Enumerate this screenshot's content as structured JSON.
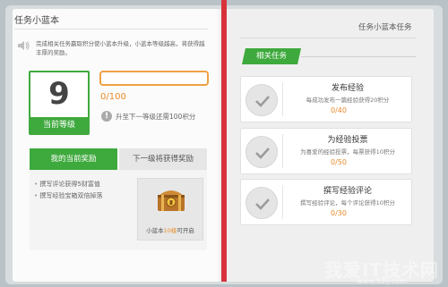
{
  "left": {
    "title": "任务小蓝本",
    "notice": "完成相关任务赢取积分使小蓝本升级，小蓝本等级越高，将获得越丰厚的奖励。",
    "level": {
      "number": "9",
      "label": "当前等级"
    },
    "progress": {
      "text": "0/100",
      "fraction": 0
    },
    "upgrade_hint": "升至下一等级还需100积分",
    "tabs": [
      "我的当前奖励",
      "下一级将获得奖励"
    ],
    "rewards": [
      "撰写评论获得5财富值",
      "撰写经验宝箱双倍掉落"
    ],
    "chest_caption": {
      "prefix": "小蓝本",
      "highlight": "10级",
      "suffix": "可开启"
    }
  },
  "right": {
    "title": "任务小蓝本任务",
    "section": "相关任务",
    "tasks": [
      {
        "title": "发布经验",
        "desc": "每成功发布一篇经验获得20积分",
        "progress": "0/40"
      },
      {
        "title": "为经验投票",
        "desc": "为喜爱的经验投票，每票获得10积分",
        "progress": "0/50"
      },
      {
        "title": "撰写经验评论",
        "desc": "撰写经验评论，每个评论获得10积分",
        "progress": "0/30"
      }
    ]
  },
  "watermark": {
    "text": "我爱IT技术网",
    "url": "www.52ij.com"
  },
  "colors": {
    "accent_green": "#3ea93c",
    "accent_orange": "#f0a043",
    "spine_red": "#d8323b"
  }
}
